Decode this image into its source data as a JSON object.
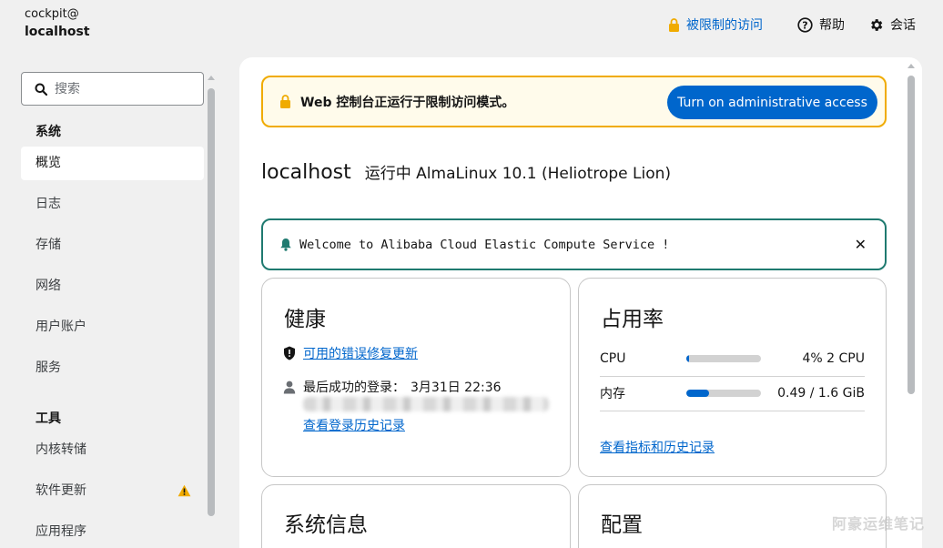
{
  "header": {
    "user": "cockpit@",
    "host": "localhost",
    "limited_access": "被限制的访问",
    "help": "帮助",
    "session": "会话"
  },
  "sidebar": {
    "search_placeholder": "搜索",
    "section_system": "系统",
    "section_tools": "工具",
    "items": [
      {
        "label": "概览"
      },
      {
        "label": "日志"
      },
      {
        "label": "存储"
      },
      {
        "label": "网络"
      },
      {
        "label": "用户账户"
      },
      {
        "label": "服务"
      }
    ],
    "tools": [
      {
        "label": "内核转储"
      },
      {
        "label": "软件更新"
      },
      {
        "label": "应用程序"
      }
    ]
  },
  "alert_admin": {
    "message": "Web 控制台正运行于限制访问模式。",
    "button": "Turn on administrative access"
  },
  "page": {
    "hostname": "localhost",
    "os": "运行中 AlmaLinux 10.1 (Heliotrope Lion)"
  },
  "welcome": {
    "message": "Welcome to Alibaba Cloud Elastic Compute Service !"
  },
  "health": {
    "title": "健康",
    "updates_link": "可用的错误修复更新",
    "last_login_label": "最后成功的登录：",
    "last_login_time": "3月31日 22:36",
    "history_link": "查看登录历史记录"
  },
  "usage": {
    "title": "占用率",
    "cpu_label": "CPU",
    "cpu_value": "4% 2 CPU",
    "cpu_fraction": 0.04,
    "mem_label": "内存",
    "mem_value": "0.49 / 1.6 GiB",
    "mem_fraction": 0.3,
    "metrics_link": "查看指标和历史记录"
  },
  "system_info": {
    "title": "系统信息"
  },
  "config": {
    "title": "配置"
  },
  "watermark": "阿豪运维笔记",
  "colors": {
    "accent": "#0066cc",
    "warning": "#f0ab00",
    "info": "#1f7a70"
  }
}
